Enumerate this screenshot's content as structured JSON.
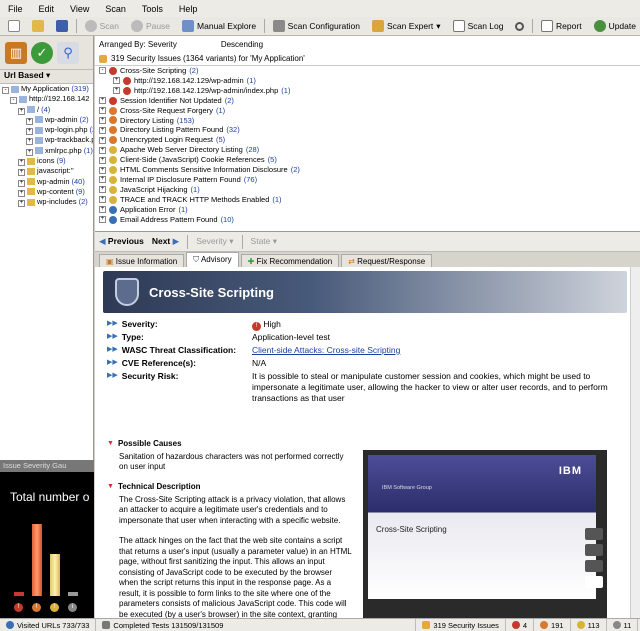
{
  "menu": [
    "File",
    "Edit",
    "View",
    "Scan",
    "Tools",
    "Help"
  ],
  "toolbar": {
    "scan": "Scan",
    "pause": "Pause",
    "manual_explore": "Manual Explore",
    "scan_configuration": "Scan Configuration",
    "scan_expert": "Scan Expert",
    "scan_log": "Scan Log",
    "report": "Report",
    "update": "Update"
  },
  "left": {
    "url_based": "Url Based",
    "tree": [
      {
        "label": "My Application",
        "count": "(319)",
        "indent": 0
      },
      {
        "label": "http://192.168.142",
        "count": "",
        "indent": 1
      },
      {
        "label": "/",
        "count": "(4)",
        "indent": 2
      },
      {
        "label": "wp-admin",
        "count": "(2)",
        "indent": 3
      },
      {
        "label": "wp-login.php",
        "count": "(2)",
        "indent": 3
      },
      {
        "label": "wp-trackback.p",
        "count": "",
        "indent": 3
      },
      {
        "label": "xmlrpc.php",
        "count": "(1)",
        "indent": 3
      },
      {
        "label": "icons",
        "count": "(9)",
        "indent": 2
      },
      {
        "label": "javascript:''",
        "count": "",
        "indent": 2
      },
      {
        "label": "wp-admin",
        "count": "(40)",
        "indent": 2
      },
      {
        "label": "wp-content",
        "count": "(9)",
        "indent": 2
      },
      {
        "label": "wp-includes",
        "count": "(2)",
        "indent": 2
      }
    ]
  },
  "severity_panel": {
    "header": "Issue Severity Gau",
    "title": "Total number o"
  },
  "issues": {
    "arranged_by_label": "Arranged By: Severity",
    "order": "Descending",
    "summary": "319 Security Issues (1364 variants) for 'My Application'",
    "list": [
      {
        "label": "Cross-Site Scripting",
        "count": "(2)",
        "level": 0,
        "sev": "high",
        "exp": "-"
      },
      {
        "label": "http://192.168.142.129/wp-admin",
        "count": "(1)",
        "level": 1,
        "sev": "high",
        "exp": "+"
      },
      {
        "label": "http://192.168.142.129/wp-admin/index.php",
        "count": "(1)",
        "level": 1,
        "sev": "high",
        "exp": "+"
      },
      {
        "label": "Session Identifier Not Updated",
        "count": "(2)",
        "level": 0,
        "sev": "high",
        "exp": "+"
      },
      {
        "label": "Cross-Site Request Forgery",
        "count": "(1)",
        "level": 0,
        "sev": "med",
        "exp": "+"
      },
      {
        "label": "Directory Listing",
        "count": "(153)",
        "level": 0,
        "sev": "med",
        "exp": "+"
      },
      {
        "label": "Directory Listing Pattern Found",
        "count": "(32)",
        "level": 0,
        "sev": "med",
        "exp": "+"
      },
      {
        "label": "Unencrypted Login Request",
        "count": "(5)",
        "level": 0,
        "sev": "med",
        "exp": "+"
      },
      {
        "label": "Apache Web Server Directory Listing",
        "count": "(28)",
        "level": 0,
        "sev": "low",
        "exp": "+"
      },
      {
        "label": "Client-Side (JavaScript) Cookie References",
        "count": "(5)",
        "level": 0,
        "sev": "low",
        "exp": "+"
      },
      {
        "label": "HTML Comments Sensitive Information Disclosure",
        "count": "(2)",
        "level": 0,
        "sev": "low",
        "exp": "+"
      },
      {
        "label": "Internal IP Disclosure Pattern Found",
        "count": "(76)",
        "level": 0,
        "sev": "low",
        "exp": "+"
      },
      {
        "label": "JavaScript Hijacking",
        "count": "(1)",
        "level": 0,
        "sev": "low",
        "exp": "+"
      },
      {
        "label": "TRACE and TRACK HTTP Methods Enabled",
        "count": "(1)",
        "level": 0,
        "sev": "low",
        "exp": "+"
      },
      {
        "label": "Application Error",
        "count": "(1)",
        "level": 0,
        "sev": "info",
        "exp": "+"
      },
      {
        "label": "Email Address Pattern Found",
        "count": "(10)",
        "level": 0,
        "sev": "info",
        "exp": "+"
      }
    ]
  },
  "nav": {
    "previous": "Previous",
    "next": "Next",
    "severity": "Severity",
    "state": "State"
  },
  "tabs": [
    "Issue Information",
    "Advisory",
    "Fix Recommendation",
    "Request/Response"
  ],
  "advisory": {
    "title": "Cross-Site Scripting",
    "severity_k": "Severity:",
    "severity_v": "High",
    "type_k": "Type:",
    "type_v": "Application-level test",
    "wasc_k": "WASC Threat Classification:",
    "wasc_v": "Client-side Attacks: Cross-site Scripting",
    "cve_k": "CVE Reference(s):",
    "cve_v": "N/A",
    "risk_k": "Security Risk:",
    "risk_v": "It is possible to steal or manipulate customer session and cookies, which might be used to impersonate a legitimate user, allowing the hacker to view or alter user records, and to perform transactions as that user",
    "causes_h": "Possible Causes",
    "causes_v": "Sanitation of hazardous characters was not performed correctly on user input",
    "tech_h": "Technical Description",
    "tech_p1": "The Cross-Site Scripting attack is a privacy violation, that allows an attacker to acquire a legitimate user's credentials and to impersonate that user when interacting with a specific website.",
    "tech_p2": "The attack hinges on the fact that the web site contains a script that returns a user's input (usually a parameter value) in an HTML page, without first sanitizing the input. This allows an input consisting of JavaScript code to be executed by the browser when the script returns this input in the response page. As a result, it is possible to form links to the site where one of the parameters consists of malicious JavaScript code. This code will be executed (by a user's browser) in the site context, granting"
  },
  "video": {
    "brand": "IBM",
    "group": "IBM Software Group",
    "title": "Cross-Site Scripting"
  },
  "status": {
    "visited": "Visited URLs 733/733",
    "completed": "Completed Tests 131509/131509",
    "issues": "319 Security Issues",
    "high": "4",
    "medium": "191",
    "low": "113",
    "info": "11"
  }
}
